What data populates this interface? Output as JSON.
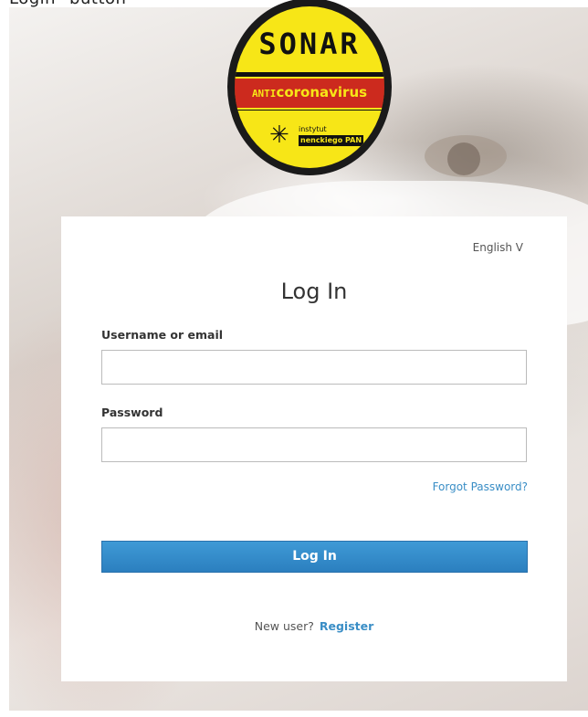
{
  "caption": "Login\" button",
  "badge": {
    "title": "SONAR",
    "band_prefix": "ANTI",
    "band_main": "coronavirus",
    "institute_line1": "instytut",
    "institute_line2": "nenckiego PAN",
    "colors": {
      "yellow": "#f7e617",
      "red": "#cc2a1e",
      "black": "#111111"
    }
  },
  "login_card": {
    "language": "English V",
    "title": "Log In",
    "username_label": "Username or email",
    "username_value": "",
    "password_label": "Password",
    "password_value": "",
    "forgot_password": "Forgot Password?",
    "login_button": "Log In",
    "new_user": "New user?",
    "register": "Register",
    "accent_color": "#3a8ec6"
  }
}
